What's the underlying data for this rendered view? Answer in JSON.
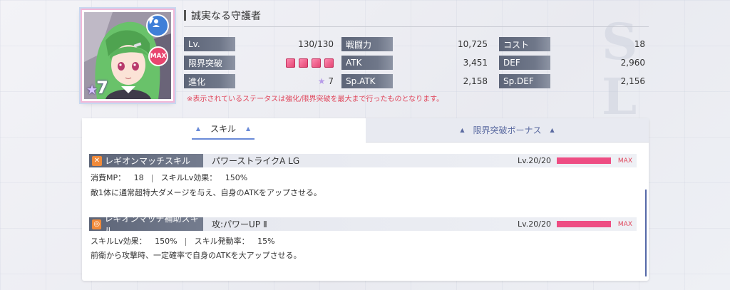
{
  "character": {
    "title": "誠実なる守護者",
    "rank": "7",
    "max_badge": "MAX",
    "stats": {
      "level": {
        "label": "Lv.",
        "value": "130/130"
      },
      "limit_break": {
        "label": "限界突破",
        "gems": 4
      },
      "evolution": {
        "label": "進化",
        "value": "7"
      },
      "combat_power": {
        "label": "戦闘力",
        "value": "10,725"
      },
      "atk": {
        "label": "ATK",
        "value": "3,451"
      },
      "sp_atk": {
        "label": "Sp.ATK",
        "value": "2,158"
      },
      "cost": {
        "label": "コスト",
        "value": "18"
      },
      "def": {
        "label": "DEF",
        "value": "2,960"
      },
      "sp_def": {
        "label": "Sp.DEF",
        "value": "2,156"
      }
    },
    "note": "※表示されているステータスは強化/限界突破を最大まで行ったものとなります。"
  },
  "tabs": {
    "skill": "スキル",
    "limit_bonus": "限界突破ボーナス"
  },
  "skills": [
    {
      "type": "レギオンマッチスキル",
      "name": "パワーストライクA LG",
      "level": "Lv.20/20",
      "level_fraction": 1.0,
      "max": "MAX",
      "line1_a": "消費MP：",
      "line1_a_val": "18",
      "line1_b": "スキルLv効果：",
      "line1_b_val": "150%",
      "description": "敵1体に通常超特大ダメージを与え、自身のATKをアップさせる。",
      "icon_color": "#f08a3a"
    },
    {
      "type": "レギオンマッチ補助スキル",
      "name": "攻:パワーUP Ⅱ",
      "level": "Lv.20/20",
      "level_fraction": 1.0,
      "max": "MAX",
      "line1_a": "スキルLv効果：",
      "line1_a_val": "150%",
      "line1_b": "スキル発動率：",
      "line1_b_val": "15%",
      "description": "前衛から攻撃時、一定確率で自身のATKを大アップさせる。",
      "icon_color": "#f08a3a"
    }
  ],
  "colors": {
    "accent": "#ee4d83",
    "label_bg": "#5d6578",
    "note": "#e0455a"
  }
}
